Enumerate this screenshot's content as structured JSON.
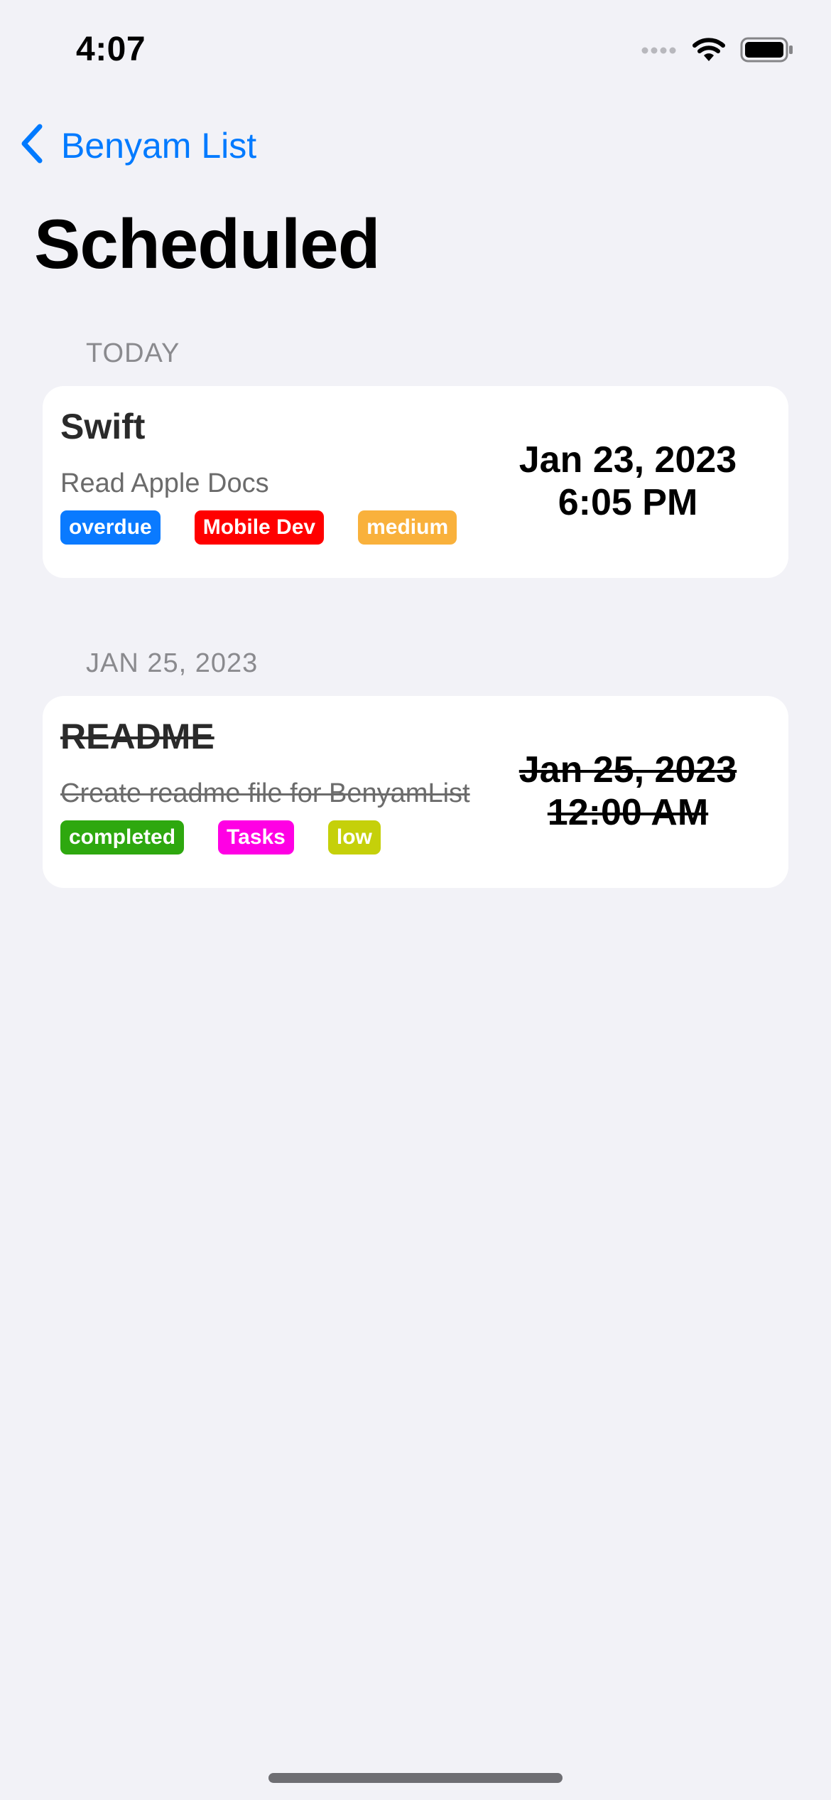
{
  "status_bar": {
    "time": "4:07",
    "icons": [
      "cellular-dots-icon",
      "wifi-icon",
      "battery-icon"
    ]
  },
  "nav": {
    "back_label": "Benyam List"
  },
  "page": {
    "title": "Scheduled"
  },
  "sections": [
    {
      "header": "TODAY",
      "items": [
        {
          "title": "Swift",
          "subtitle": "Read Apple Docs",
          "date_line1": "Jan 23, 2023",
          "date_line2": "6:05 PM",
          "completed": false,
          "tags": [
            {
              "label": "overdue",
              "color": "#0a7aff"
            },
            {
              "label": "Mobile Dev",
              "color": "#ff0000"
            },
            {
              "label": "medium",
              "color": "#f9b13c"
            }
          ]
        }
      ]
    },
    {
      "header": "JAN 25, 2023",
      "items": [
        {
          "title": "README",
          "subtitle": "Create readme file for BenyamList",
          "date_line1": "Jan 25, 2023",
          "date_line2": "12:00 AM",
          "completed": true,
          "tags": [
            {
              "label": "completed",
              "color": "#2ea80f"
            },
            {
              "label": "Tasks",
              "color": "#ff00e4"
            },
            {
              "label": "low",
              "color": "#c5d00a"
            }
          ]
        }
      ]
    }
  ],
  "colors": {
    "accent": "#007aff",
    "background": "#f2f2f7",
    "card": "#ffffff"
  }
}
